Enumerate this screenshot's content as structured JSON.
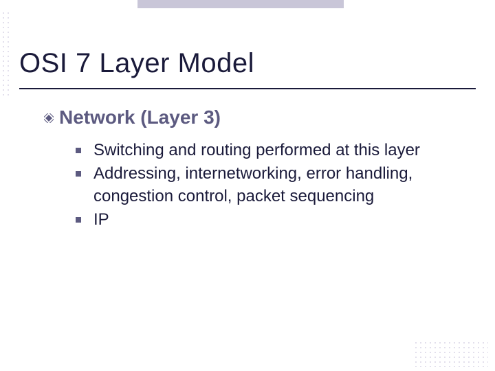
{
  "slide": {
    "title": "OSI 7 Layer Model",
    "heading": "Network (Layer 3)",
    "bullets": [
      "Switching and routing performed at this layer",
      "Addressing, internetworking, error handling, congestion control, packet sequencing",
      "IP"
    ]
  }
}
